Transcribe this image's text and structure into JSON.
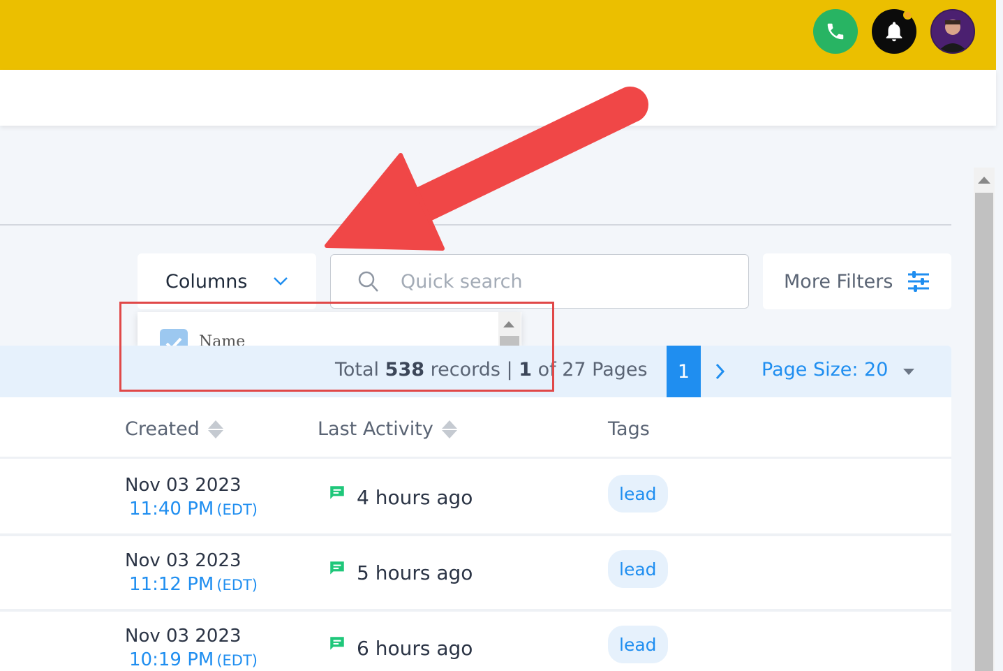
{
  "header": {
    "phone_icon": "phone-icon",
    "bell_icon": "bell-icon",
    "avatar_icon": "user-avatar"
  },
  "toolbar": {
    "columns_label": "Columns",
    "search_placeholder": "Quick search",
    "more_filters_label": "More Filters"
  },
  "columns_dropdown": {
    "first_item_label": "Name",
    "first_item_checked": true
  },
  "pagination": {
    "total_prefix": "Total",
    "total_count": "538",
    "records_label": "records |",
    "current_page": "1",
    "of_label": "of 27 Pages",
    "active_page": "1",
    "page_size_label": "Page Size: 20"
  },
  "table": {
    "headers": [
      "Created",
      "Last Activity",
      "Tags"
    ],
    "rows": [
      {
        "date": "Nov 03 2023",
        "time": "11:40 PM",
        "tz": "(EDT)",
        "activity": "4 hours ago",
        "tag": "lead"
      },
      {
        "date": "Nov 03 2023",
        "time": "11:12 PM",
        "tz": "(EDT)",
        "activity": "5 hours ago",
        "tag": "lead"
      },
      {
        "date": "Nov 03 2023",
        "time": "10:19 PM",
        "tz": "(EDT)",
        "activity": "6 hours ago",
        "tag": "lead"
      }
    ]
  },
  "colors": {
    "topbar": "#ebbf00",
    "accent": "#1f8ef0",
    "phone": "#28b463",
    "annotation": "#f04747"
  }
}
